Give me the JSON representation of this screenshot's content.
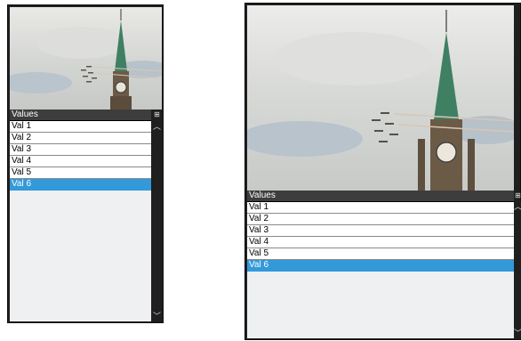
{
  "left_panel": {
    "list_header": "Values",
    "items": [
      "Val 1",
      "Val 2",
      "Val 3",
      "Val 4",
      "Val 5",
      "Val 6"
    ],
    "selected_index": 5
  },
  "right_panel": {
    "list_header": "Values",
    "items": [
      "Val 1",
      "Val 2",
      "Val 3",
      "Val 4",
      "Val 5",
      "Val 6"
    ],
    "selected_index": 5
  },
  "icons": {
    "scroll_up": "chevron-up-icon",
    "scroll_down": "chevron-down-icon",
    "corner": "expand-icon"
  },
  "colors": {
    "selection": "#3399d9",
    "frame": "#1f1f1f",
    "header": "#3d3d3d"
  }
}
